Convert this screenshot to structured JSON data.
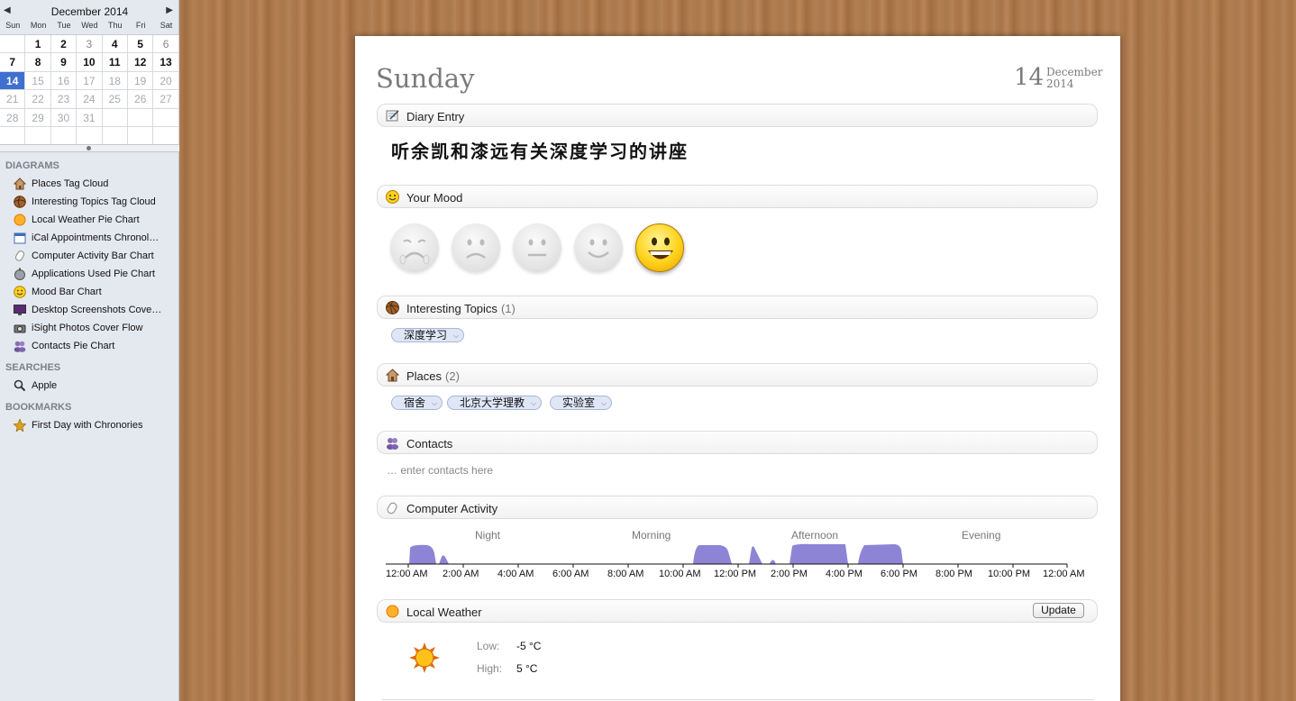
{
  "calendar": {
    "title": "December 2014",
    "prev": "◀",
    "next": "▶",
    "weekdays": [
      "Sun",
      "Mon",
      "Tue",
      "Wed",
      "Thu",
      "Fri",
      "Sat"
    ],
    "cells": [
      {
        "t": "",
        "s": "bold"
      },
      {
        "t": "1",
        "s": "bold"
      },
      {
        "t": "2",
        "s": "bold"
      },
      {
        "t": "3",
        "s": "dim"
      },
      {
        "t": "4",
        "s": "bold"
      },
      {
        "t": "5",
        "s": "bold"
      },
      {
        "t": "6",
        "s": "dim"
      },
      {
        "t": "7",
        "s": "bold"
      },
      {
        "t": "8",
        "s": "bold"
      },
      {
        "t": "9",
        "s": "bold"
      },
      {
        "t": "10",
        "s": "bold"
      },
      {
        "t": "11",
        "s": "bold"
      },
      {
        "t": "12",
        "s": "bold"
      },
      {
        "t": "13",
        "s": "bold"
      },
      {
        "t": "14",
        "s": "sel"
      },
      {
        "t": "15",
        "s": "muted"
      },
      {
        "t": "16",
        "s": "muted"
      },
      {
        "t": "17",
        "s": "muted"
      },
      {
        "t": "18",
        "s": "muted"
      },
      {
        "t": "19",
        "s": "muted"
      },
      {
        "t": "20",
        "s": "muted"
      },
      {
        "t": "21",
        "s": "muted"
      },
      {
        "t": "22",
        "s": "muted"
      },
      {
        "t": "23",
        "s": "muted"
      },
      {
        "t": "24",
        "s": "muted"
      },
      {
        "t": "25",
        "s": "muted"
      },
      {
        "t": "26",
        "s": "muted"
      },
      {
        "t": "27",
        "s": "muted"
      },
      {
        "t": "28",
        "s": "muted"
      },
      {
        "t": "29",
        "s": "muted"
      },
      {
        "t": "30",
        "s": "muted"
      },
      {
        "t": "31",
        "s": "muted"
      },
      {
        "t": "",
        "s": "muted"
      },
      {
        "t": "",
        "s": "muted"
      },
      {
        "t": "",
        "s": "muted"
      },
      {
        "t": "",
        "s": "muted"
      },
      {
        "t": "",
        "s": "muted"
      },
      {
        "t": "",
        "s": "muted"
      },
      {
        "t": "",
        "s": "muted"
      },
      {
        "t": "",
        "s": "muted"
      },
      {
        "t": "",
        "s": "muted"
      },
      {
        "t": "",
        "s": "muted"
      }
    ]
  },
  "sidebar": {
    "diagrams_header": "DIAGRAMS",
    "diagrams": [
      {
        "label": "Places Tag Cloud",
        "icon": "house-icon"
      },
      {
        "label": "Interesting Topics Tag Cloud",
        "icon": "topics-ball-icon"
      },
      {
        "label": "Local Weather Pie Chart",
        "icon": "sun-icon"
      },
      {
        "label": "iCal Appointments Chronol…",
        "icon": "calendar-icon"
      },
      {
        "label": "Computer Activity Bar Chart",
        "icon": "mouse-icon"
      },
      {
        "label": "Applications Used Pie Chart",
        "icon": "applications-icon"
      },
      {
        "label": "Mood Bar Chart",
        "icon": "smiley-icon"
      },
      {
        "label": "Desktop Screenshots Cove…",
        "icon": "monitor-icon"
      },
      {
        "label": "iSight Photos Cover Flow",
        "icon": "camera-icon"
      },
      {
        "label": "Contacts Pie Chart",
        "icon": "contacts-icon"
      }
    ],
    "searches_header": "SEARCHES",
    "searches": [
      {
        "label": "Apple",
        "icon": "search-icon"
      }
    ],
    "bookmarks_header": "BOOKMARKS",
    "bookmarks": [
      {
        "label": "First Day with Chronories",
        "icon": "star-icon"
      }
    ]
  },
  "page": {
    "day_name": "Sunday",
    "day_number": "14",
    "month": "December",
    "year": "2014",
    "diary": {
      "title": "Diary Entry",
      "text": "听余凯和漆远有关深度学习的讲座"
    },
    "mood": {
      "title": "Your Mood",
      "levels": 5,
      "selected": 5
    },
    "topics": {
      "title": "Interesting Topics",
      "count": "(1)",
      "tags": [
        "深度学习"
      ]
    },
    "places": {
      "title": "Places",
      "count": "(2)",
      "tags": [
        "宿舍",
        "北京大学理教",
        "实验室"
      ]
    },
    "contacts": {
      "title": "Contacts",
      "placeholder": "… enter contacts here"
    },
    "activity": {
      "title": "Computer Activity",
      "segments": [
        "Night",
        "Morning",
        "Afternoon",
        "Evening"
      ],
      "time_labels": [
        "12:00 AM",
        "2:00 AM",
        "4:00 AM",
        "6:00 AM",
        "8:00 AM",
        "10:00 AM",
        "12:00 PM",
        "2:00 PM",
        "4:00 PM",
        "6:00 PM",
        "8:00 PM",
        "10:00 PM",
        "12:00 AM"
      ],
      "color": "#8e84d6"
    },
    "weather": {
      "title": "Local Weather",
      "update": "Update",
      "low_label": "Low:",
      "low": "-5 °C",
      "high_label": "High:",
      "high": "5 °C"
    }
  }
}
